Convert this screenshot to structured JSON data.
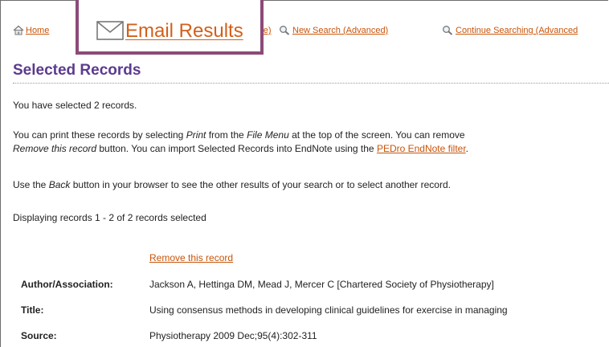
{
  "nav": {
    "home": "Home",
    "example_fragment": "mple)",
    "new_search": "New Search (Advanced)",
    "continue_searching": "Continue Searching (Advanced"
  },
  "callout": {
    "label": "Email Results"
  },
  "page": {
    "title": "Selected Records",
    "selected_count_text": "You have selected 2 records.",
    "print_line": {
      "a": "You can print these records by selecting ",
      "print": "Print",
      "b": " from the ",
      "file_menu": "File Menu",
      "c": " at the top of the screen. You can remove"
    },
    "remove_line": {
      "remove_record": "Remove this record",
      "a": " button. You can import Selected Records into EndNote using the ",
      "filter_link": "PEDro EndNote filter",
      "b": "."
    },
    "back_line": {
      "a": "Use the ",
      "back": "Back",
      "b": " button in your browser to see the other results of your search or to select another record."
    },
    "displaying": "Displaying records 1 - 2 of 2 records selected"
  },
  "record": {
    "remove_link": "Remove this record",
    "fields": [
      {
        "label": "Author/Association:",
        "value": "Jackson A, Hettinga DM, Mead J, Mercer C [Chartered Society of Physiotherapy]"
      },
      {
        "label": "Title:",
        "value": "Using consensus methods in developing clinical guidelines for exercise in managing"
      },
      {
        "label": "Source:",
        "value": "Physiotherapy 2009 Dec;95(4):302-311"
      }
    ]
  },
  "colors": {
    "link": "#c8540a",
    "title": "#5c3b8e",
    "callout_border": "#8c4a78"
  },
  "icons": [
    "home-icon",
    "magnifier-icon",
    "envelope-icon"
  ]
}
